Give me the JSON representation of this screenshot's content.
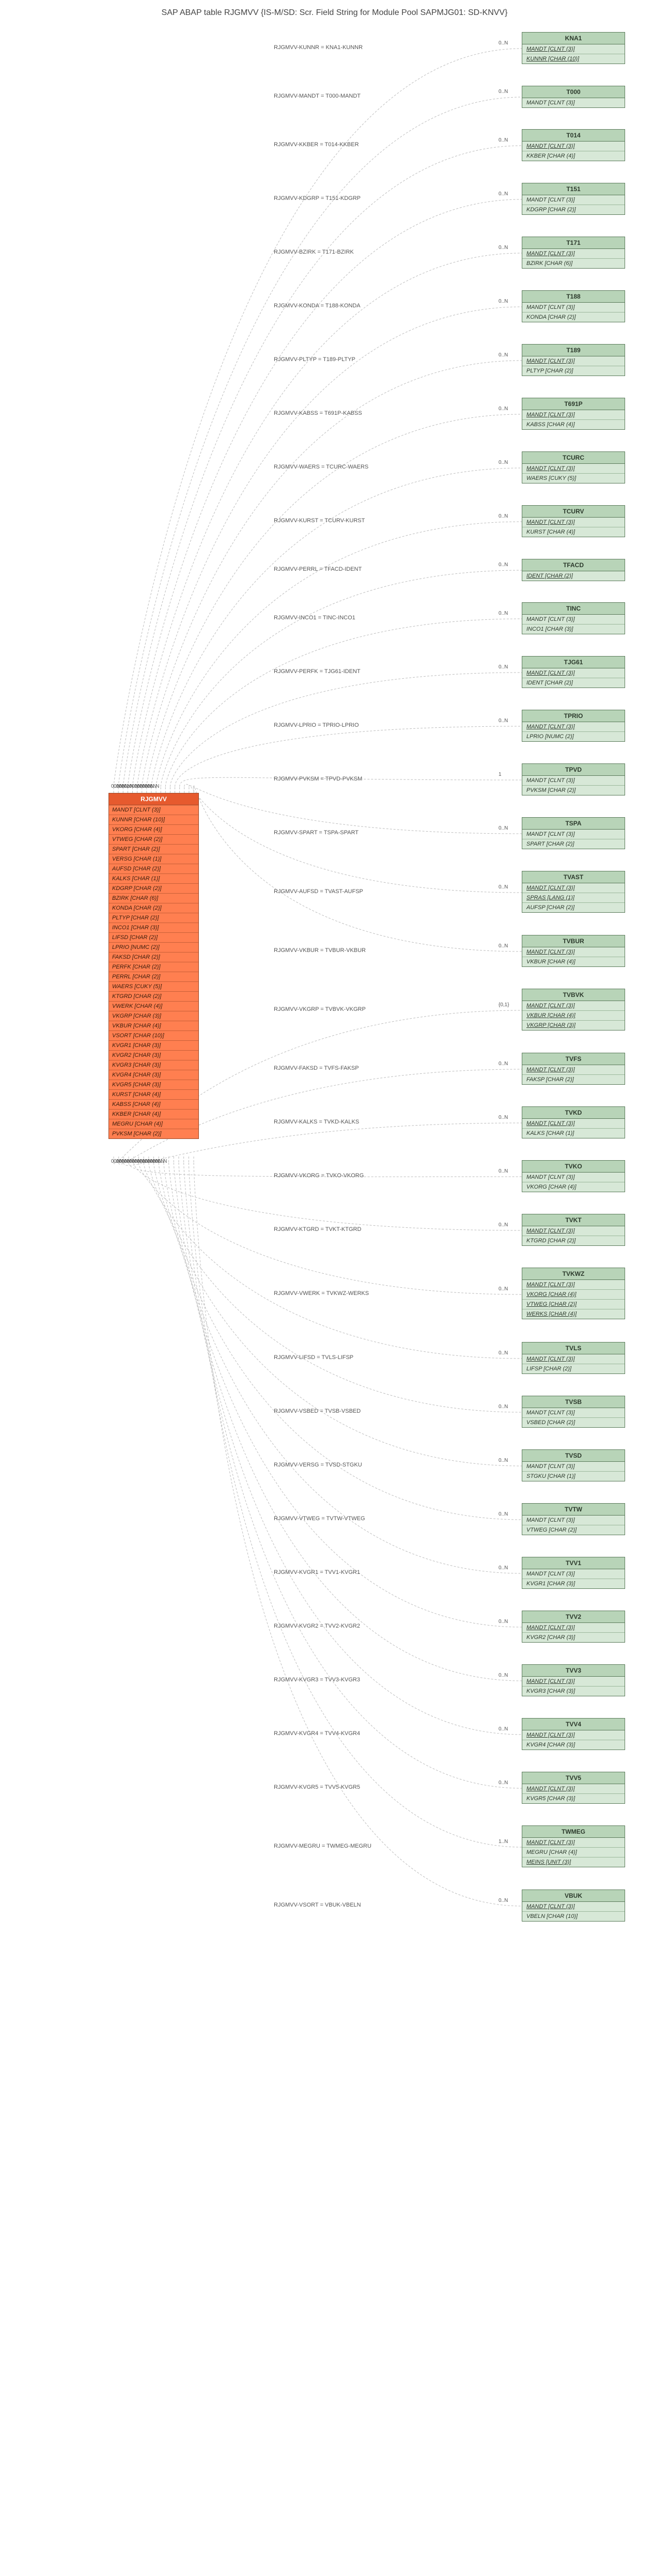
{
  "title": "SAP ABAP table RJGMVV {IS-M/SD: Scr. Field String for Module Pool SAPMJG01: SD-KNVV}",
  "main": {
    "name": "RJGMVV",
    "fields": [
      "MANDT [CLNT (3)]",
      "KUNNR [CHAR (10)]",
      "VKORG [CHAR (4)]",
      "VTWEG [CHAR (2)]",
      "SPART [CHAR (2)]",
      "VERSG [CHAR (1)]",
      "AUFSD [CHAR (2)]",
      "KALKS [CHAR (1)]",
      "KDGRP [CHAR (2)]",
      "BZIRK [CHAR (6)]",
      "KONDA [CHAR (2)]",
      "PLTYP [CHAR (2)]",
      "INCO1 [CHAR (3)]",
      "LIFSD [CHAR (2)]",
      "LPRIO [NUMC (2)]",
      "FAKSD [CHAR (2)]",
      "PERFK [CHAR (2)]",
      "PERRL [CHAR (2)]",
      "WAERS [CUKY (5)]",
      "KTGRD [CHAR (2)]",
      "VWERK [CHAR (4)]",
      "VKGRP [CHAR (3)]",
      "VKBUR [CHAR (4)]",
      "VSORT [CHAR (10)]",
      "KVGR1 [CHAR (3)]",
      "KVGR2 [CHAR (3)]",
      "KVGR3 [CHAR (3)]",
      "KVGR4 [CHAR (3)]",
      "KVGR5 [CHAR (3)]",
      "KURST [CHAR (4)]",
      "KABSS [CHAR (4)]",
      "KKBER [CHAR (4)]",
      "MEGRU [CHAR (4)]",
      "PVKSM [CHAR (2)]"
    ]
  },
  "green": [
    {
      "name": "KNA1",
      "rows": [
        {
          "t": "MANDT [CLNT (3)]",
          "u": true
        },
        {
          "t": "KUNNR [CHAR (10)]",
          "u": true
        }
      ],
      "edge": "RJGMVV-KUNNR = KNA1-KUNNR",
      "card": "0..N"
    },
    {
      "name": "T000",
      "rows": [
        {
          "t": "MANDT [CLNT (3)]",
          "u": false
        }
      ],
      "edge": "RJGMVV-MANDT = T000-MANDT",
      "card": "0..N"
    },
    {
      "name": "T014",
      "rows": [
        {
          "t": "MANDT [CLNT (3)]",
          "u": true
        },
        {
          "t": "KKBER [CHAR (4)]",
          "u": false
        }
      ],
      "edge": "RJGMVV-KKBER = T014-KKBER",
      "card": "0..N"
    },
    {
      "name": "T151",
      "rows": [
        {
          "t": "MANDT [CLNT (3)]",
          "u": false
        },
        {
          "t": "KDGRP [CHAR (2)]",
          "u": false
        }
      ],
      "edge": "RJGMVV-KDGRP = T151-KDGRP",
      "card": "0..N"
    },
    {
      "name": "T171",
      "rows": [
        {
          "t": "MANDT [CLNT (3)]",
          "u": true
        },
        {
          "t": "BZIRK [CHAR (6)]",
          "u": false
        }
      ],
      "edge": "RJGMVV-BZIRK = T171-BZIRK",
      "card": "0..N"
    },
    {
      "name": "T188",
      "rows": [
        {
          "t": "MANDT [CLNT (3)]",
          "u": false
        },
        {
          "t": "KONDA [CHAR (2)]",
          "u": false
        }
      ],
      "edge": "RJGMVV-KONDA = T188-KONDA",
      "card": "0..N"
    },
    {
      "name": "T189",
      "rows": [
        {
          "t": "MANDT [CLNT (3)]",
          "u": true
        },
        {
          "t": "PLTYP [CHAR (2)]",
          "u": false
        }
      ],
      "edge": "RJGMVV-PLTYP = T189-PLTYP",
      "card": "0..N"
    },
    {
      "name": "T691P",
      "rows": [
        {
          "t": "MANDT [CLNT (3)]",
          "u": true
        },
        {
          "t": "KABSS [CHAR (4)]",
          "u": false
        }
      ],
      "edge": "RJGMVV-KABSS = T691P-KABSS",
      "card": "0..N"
    },
    {
      "name": "TCURC",
      "rows": [
        {
          "t": "MANDT [CLNT (3)]",
          "u": true
        },
        {
          "t": "WAERS [CUKY (5)]",
          "u": false
        }
      ],
      "edge": "RJGMVV-WAERS = TCURC-WAERS",
      "card": "0..N"
    },
    {
      "name": "TCURV",
      "rows": [
        {
          "t": "MANDT [CLNT (3)]",
          "u": true
        },
        {
          "t": "KURST [CHAR (4)]",
          "u": false
        }
      ],
      "edge": "RJGMVV-KURST = TCURV-KURST",
      "card": "0..N"
    },
    {
      "name": "TFACD",
      "rows": [
        {
          "t": "IDENT [CHAR (2)]",
          "u": true
        }
      ],
      "edge": "RJGMVV-PERRL = TFACD-IDENT",
      "card": "0..N"
    },
    {
      "name": "TINC",
      "rows": [
        {
          "t": "MANDT [CLNT (3)]",
          "u": false
        },
        {
          "t": "INCO1 [CHAR (3)]",
          "u": false
        }
      ],
      "edge": "RJGMVV-INCO1 = TINC-INCO1",
      "card": "0..N"
    },
    {
      "name": "TJG61",
      "rows": [
        {
          "t": "MANDT [CLNT (3)]",
          "u": true
        },
        {
          "t": "IDENT [CHAR (2)]",
          "u": false
        }
      ],
      "edge": "RJGMVV-PERFK = TJG61-IDENT",
      "card": "0..N"
    },
    {
      "name": "TPRIO",
      "rows": [
        {
          "t": "MANDT [CLNT (3)]",
          "u": true
        },
        {
          "t": "LPRIO [NUMC (2)]",
          "u": false
        }
      ],
      "edge": "RJGMVV-LPRIO = TPRIO-LPRIO",
      "card": "0..N"
    },
    {
      "name": "TPVD",
      "rows": [
        {
          "t": "MANDT [CLNT (3)]",
          "u": false
        },
        {
          "t": "PVKSM [CHAR (2)]",
          "u": false
        }
      ],
      "edge": "RJGMVV-PVKSM = TPVD-PVKSM",
      "card": "1"
    },
    {
      "name": "TSPA",
      "rows": [
        {
          "t": "MANDT [CLNT (3)]",
          "u": false
        },
        {
          "t": "SPART [CHAR (2)]",
          "u": false
        }
      ],
      "edge": "RJGMVV-SPART = TSPA-SPART",
      "card": "0..N"
    },
    {
      "name": "TVAST",
      "rows": [
        {
          "t": "MANDT [CLNT (3)]",
          "u": true
        },
        {
          "t": "SPRAS [LANG (1)]",
          "u": true
        },
        {
          "t": "AUFSP [CHAR (2)]",
          "u": false
        }
      ],
      "edge": "RJGMVV-AUFSD = TVAST-AUFSP",
      "card": "0..N"
    },
    {
      "name": "TVBUR",
      "rows": [
        {
          "t": "MANDT [CLNT (3)]",
          "u": true
        },
        {
          "t": "VKBUR [CHAR (4)]",
          "u": false
        }
      ],
      "edge": "RJGMVV-VKBUR = TVBUR-VKBUR",
      "card": "0..N"
    },
    {
      "name": "TVBVK",
      "rows": [
        {
          "t": "MANDT [CLNT (3)]",
          "u": true
        },
        {
          "t": "VKBUR [CHAR (4)]",
          "u": true
        },
        {
          "t": "VKGRP [CHAR (3)]",
          "u": true
        }
      ],
      "edge": "RJGMVV-VKGRP = TVBVK-VKGRP",
      "card": "{0,1}"
    },
    {
      "name": "TVFS",
      "rows": [
        {
          "t": "MANDT [CLNT (3)]",
          "u": true
        },
        {
          "t": "FAKSP [CHAR (2)]",
          "u": false
        }
      ],
      "edge": "RJGMVV-FAKSD = TVFS-FAKSP",
      "card": "0..N"
    },
    {
      "name": "TVKD",
      "rows": [
        {
          "t": "MANDT [CLNT (3)]",
          "u": true
        },
        {
          "t": "KALKS [CHAR (1)]",
          "u": false
        }
      ],
      "edge": "RJGMVV-KALKS = TVKD-KALKS",
      "card": "0..N"
    },
    {
      "name": "TVKO",
      "rows": [
        {
          "t": "MANDT [CLNT (3)]",
          "u": false
        },
        {
          "t": "VKORG [CHAR (4)]",
          "u": false
        }
      ],
      "edge": "RJGMVV-VKORG = TVKO-VKORG",
      "card": "0..N"
    },
    {
      "name": "TVKT",
      "rows": [
        {
          "t": "MANDT [CLNT (3)]",
          "u": true
        },
        {
          "t": "KTGRD [CHAR (2)]",
          "u": false
        }
      ],
      "edge": "RJGMVV-KTGRD = TVKT-KTGRD",
      "card": "0..N"
    },
    {
      "name": "TVKWZ",
      "rows": [
        {
          "t": "MANDT [CLNT (3)]",
          "u": true
        },
        {
          "t": "VKORG [CHAR (4)]",
          "u": true
        },
        {
          "t": "VTWEG [CHAR (2)]",
          "u": true
        },
        {
          "t": "WERKS [CHAR (4)]",
          "u": true
        }
      ],
      "edge": "RJGMVV-VWERK = TVKWZ-WERKS",
      "card": "0..N"
    },
    {
      "name": "TVLS",
      "rows": [
        {
          "t": "MANDT [CLNT (3)]",
          "u": true
        },
        {
          "t": "LIFSP [CHAR (2)]",
          "u": false
        }
      ],
      "edge": "RJGMVV-LIFSD = TVLS-LIFSP",
      "card": "0..N"
    },
    {
      "name": "TVSB",
      "rows": [
        {
          "t": "MANDT [CLNT (3)]",
          "u": false
        },
        {
          "t": "VSBED [CHAR (2)]",
          "u": false
        }
      ],
      "edge": "RJGMVV-VSBED = TVSB-VSBED",
      "card": "0..N"
    },
    {
      "name": "TVSD",
      "rows": [
        {
          "t": "MANDT [CLNT (3)]",
          "u": false
        },
        {
          "t": "STGKU [CHAR (1)]",
          "u": false
        }
      ],
      "edge": "RJGMVV-VERSG = TVSD-STGKU",
      "card": "0..N"
    },
    {
      "name": "TVTW",
      "rows": [
        {
          "t": "MANDT [CLNT (3)]",
          "u": false
        },
        {
          "t": "VTWEG [CHAR (2)]",
          "u": false
        }
      ],
      "edge": "RJGMVV-VTWEG = TVTW-VTWEG",
      "card": "0..N"
    },
    {
      "name": "TVV1",
      "rows": [
        {
          "t": "MANDT [CLNT (3)]",
          "u": false
        },
        {
          "t": "KVGR1 [CHAR (3)]",
          "u": false
        }
      ],
      "edge": "RJGMVV-KVGR1 = TVV1-KVGR1",
      "card": "0..N"
    },
    {
      "name": "TVV2",
      "rows": [
        {
          "t": "MANDT [CLNT (3)]",
          "u": true
        },
        {
          "t": "KVGR2 [CHAR (3)]",
          "u": false
        }
      ],
      "edge": "RJGMVV-KVGR2 = TVV2-KVGR2",
      "card": "0..N"
    },
    {
      "name": "TVV3",
      "rows": [
        {
          "t": "MANDT [CLNT (3)]",
          "u": true
        },
        {
          "t": "KVGR3 [CHAR (3)]",
          "u": false
        }
      ],
      "edge": "RJGMVV-KVGR3 = TVV3-KVGR3",
      "card": "0..N"
    },
    {
      "name": "TVV4",
      "rows": [
        {
          "t": "MANDT [CLNT (3)]",
          "u": true
        },
        {
          "t": "KVGR4 [CHAR (3)]",
          "u": false
        }
      ],
      "edge": "RJGMVV-KVGR4 = TVV4-KVGR4",
      "card": "0..N"
    },
    {
      "name": "TVV5",
      "rows": [
        {
          "t": "MANDT [CLNT (3)]",
          "u": true
        },
        {
          "t": "KVGR5 [CHAR (3)]",
          "u": false
        }
      ],
      "edge": "RJGMVV-KVGR5 = TVV5-KVGR5",
      "card": "0..N"
    },
    {
      "name": "TWMEG",
      "rows": [
        {
          "t": "MANDT [CLNT (3)]",
          "u": true
        },
        {
          "t": "MEGRU [CHAR (4)]",
          "u": false
        },
        {
          "t": "MEINS [UNIT (3)]",
          "u": true
        }
      ],
      "edge": "RJGMVV-MEGRU = TWMEG-MEGRU",
      "card": "1..N"
    },
    {
      "name": "VBUK",
      "rows": [
        {
          "t": "MANDT [CLNT (3)]",
          "u": true
        },
        {
          "t": "VBELN [CHAR (10)]",
          "u": false
        }
      ],
      "edge": "RJGMVV-VSORT = VBUK-VBELN",
      "card": "0..N"
    }
  ],
  "top_labels_main": [
    "0..N",
    "0..N",
    "0..N",
    "0..N",
    "0..N",
    "0..N",
    "1",
    "0..N",
    "0..N",
    "0..N",
    "0..N",
    "0..N",
    "0..N",
    "0..N",
    "0..N",
    "0..N"
  ],
  "bottom_labels_main": [
    "0..N",
    "0..N",
    "0..N",
    "0..N",
    "0..N",
    "0..N",
    "0..N",
    "0..N",
    "0..N",
    "0..N",
    "0..N",
    "0..N",
    "0..N",
    "0..N",
    "0..N",
    "0..N",
    "0..N",
    "0..N",
    "0..N"
  ]
}
